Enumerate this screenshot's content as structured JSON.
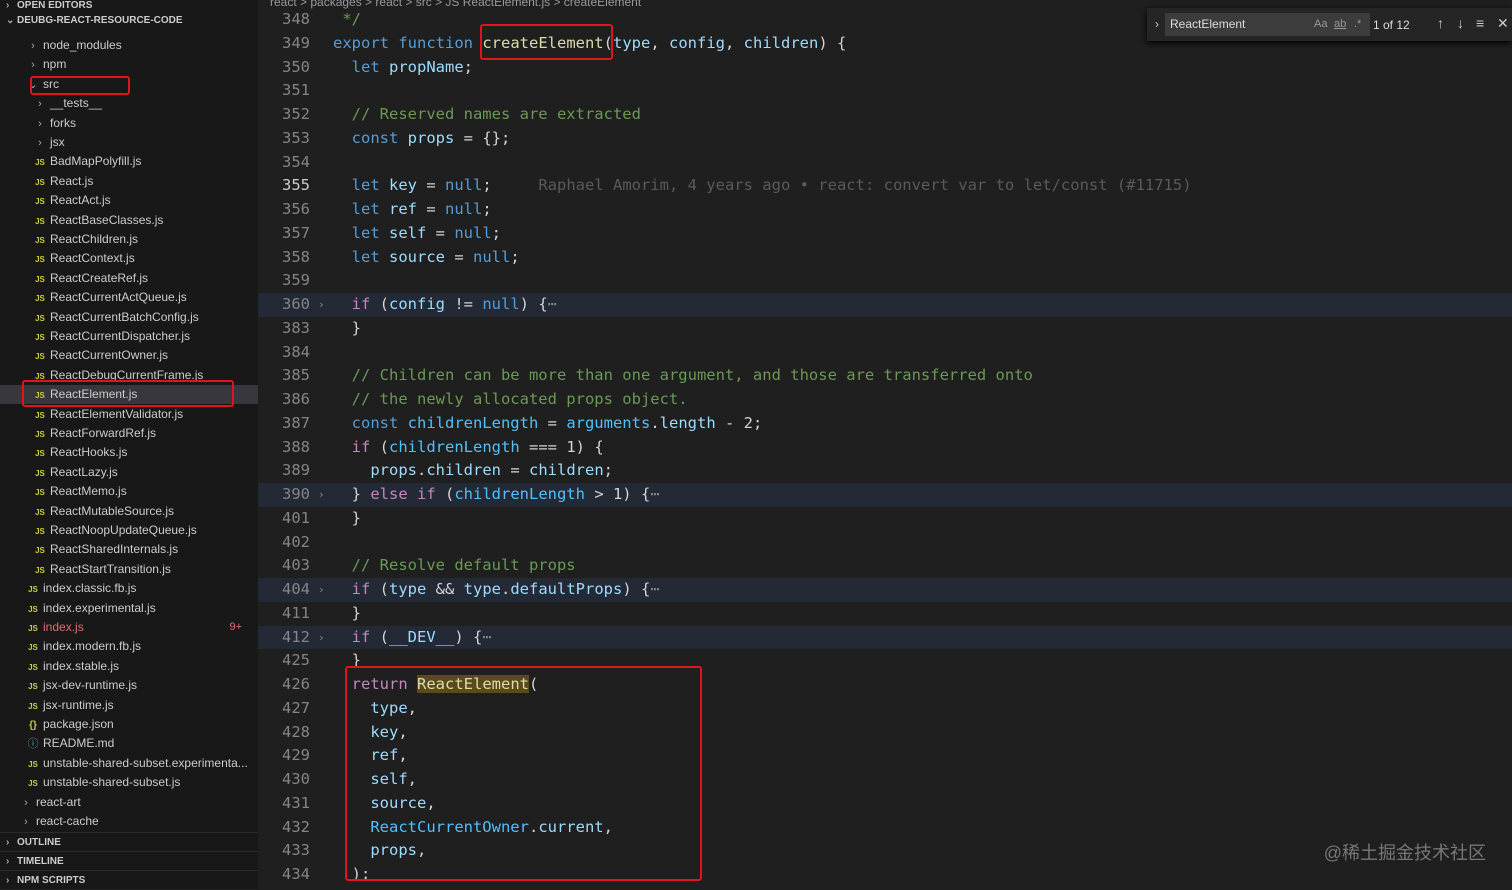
{
  "sidebar": {
    "open_editors": "OPEN EDITORS",
    "project": "DEUBG-REACT-RESOURCE-CODE",
    "tree": [
      {
        "label": "node_modules",
        "icon": "chevron-right",
        "depth": 1
      },
      {
        "label": "npm",
        "icon": "chevron-right",
        "depth": 1
      },
      {
        "label": "src",
        "icon": "chevron-down",
        "depth": 1,
        "boxed": true
      },
      {
        "label": "__tests__",
        "icon": "chevron-right",
        "depth": 2
      },
      {
        "label": "forks",
        "icon": "chevron-right",
        "depth": 2
      },
      {
        "label": "jsx",
        "icon": "chevron-right",
        "depth": 2
      },
      {
        "label": "BadMapPolyfill.js",
        "icon": "js",
        "depth": 2
      },
      {
        "label": "React.js",
        "icon": "js",
        "depth": 2
      },
      {
        "label": "ReactAct.js",
        "icon": "js",
        "depth": 2
      },
      {
        "label": "ReactBaseClasses.js",
        "icon": "js",
        "depth": 2
      },
      {
        "label": "ReactChildren.js",
        "icon": "js",
        "depth": 2
      },
      {
        "label": "ReactContext.js",
        "icon": "js",
        "depth": 2
      },
      {
        "label": "ReactCreateRef.js",
        "icon": "js",
        "depth": 2
      },
      {
        "label": "ReactCurrentActQueue.js",
        "icon": "js",
        "depth": 2
      },
      {
        "label": "ReactCurrentBatchConfig.js",
        "icon": "js",
        "depth": 2
      },
      {
        "label": "ReactCurrentDispatcher.js",
        "icon": "js",
        "depth": 2
      },
      {
        "label": "ReactCurrentOwner.js",
        "icon": "js",
        "depth": 2
      },
      {
        "label": "ReactDebugCurrentFrame.js",
        "icon": "js",
        "depth": 2
      },
      {
        "label": "ReactElement.js",
        "icon": "js",
        "depth": 2,
        "selected": true,
        "boxed": true
      },
      {
        "label": "ReactElementValidator.js",
        "icon": "js",
        "depth": 2
      },
      {
        "label": "ReactForwardRef.js",
        "icon": "js",
        "depth": 2
      },
      {
        "label": "ReactHooks.js",
        "icon": "js",
        "depth": 2
      },
      {
        "label": "ReactLazy.js",
        "icon": "js",
        "depth": 2
      },
      {
        "label": "ReactMemo.js",
        "icon": "js",
        "depth": 2
      },
      {
        "label": "ReactMutableSource.js",
        "icon": "js",
        "depth": 2
      },
      {
        "label": "ReactNoopUpdateQueue.js",
        "icon": "js",
        "depth": 2
      },
      {
        "label": "ReactSharedInternals.js",
        "icon": "js",
        "depth": 2
      },
      {
        "label": "ReactStartTransition.js",
        "icon": "js",
        "depth": 2
      },
      {
        "label": "index.classic.fb.js",
        "icon": "js",
        "depth": 1
      },
      {
        "label": "index.experimental.js",
        "icon": "js",
        "depth": 1
      },
      {
        "label": "index.js",
        "icon": "js",
        "depth": 1,
        "error": true,
        "badge": "9+"
      },
      {
        "label": "index.modern.fb.js",
        "icon": "js",
        "depth": 1
      },
      {
        "label": "index.stable.js",
        "icon": "js",
        "depth": 1
      },
      {
        "label": "jsx-dev-runtime.js",
        "icon": "js",
        "depth": 1
      },
      {
        "label": "jsx-runtime.js",
        "icon": "js",
        "depth": 1
      },
      {
        "label": "package.json",
        "icon": "json",
        "depth": 1
      },
      {
        "label": "README.md",
        "icon": "info",
        "depth": 1
      },
      {
        "label": "unstable-shared-subset.experimenta...",
        "icon": "js",
        "depth": 1
      },
      {
        "label": "unstable-shared-subset.js",
        "icon": "js",
        "depth": 1
      },
      {
        "label": "react-art",
        "icon": "chevron-right",
        "depth": 0
      },
      {
        "label": "react-cache",
        "icon": "chevron-right",
        "depth": 0
      }
    ],
    "sections": [
      "OUTLINE",
      "TIMELINE",
      "NPM SCRIPTS"
    ]
  },
  "breadcrumbs": "react > packages > react > src > JS ReactElement.js > createElement",
  "find": {
    "query": "ReactElement",
    "match_case": "Aa",
    "whole_word": "ab",
    "regex": ".*",
    "count": "1 of 12"
  },
  "lines": [
    {
      "n": "348",
      "t": [
        [
          " */",
          "c"
        ]
      ]
    },
    {
      "n": "349",
      "t": [
        [
          "export ",
          "k"
        ],
        [
          "function ",
          "k"
        ],
        [
          "createElement",
          "f"
        ],
        [
          "(",
          "t"
        ],
        [
          "type",
          "v"
        ],
        [
          ", ",
          "t"
        ],
        [
          "config",
          "v"
        ],
        [
          ", ",
          "t"
        ],
        [
          "children",
          "v"
        ],
        [
          ") {",
          "t"
        ]
      ]
    },
    {
      "n": "350",
      "t": [
        [
          "  let ",
          "k"
        ],
        [
          "propName",
          "v"
        ],
        [
          ";",
          "t"
        ]
      ]
    },
    {
      "n": "351",
      "t": []
    },
    {
      "n": "352",
      "t": [
        [
          "  // Reserved names are extracted",
          "c"
        ]
      ]
    },
    {
      "n": "353",
      "t": [
        [
          "  const ",
          "k"
        ],
        [
          "props",
          "v"
        ],
        [
          " = {};",
          "t"
        ]
      ]
    },
    {
      "n": "354",
      "t": []
    },
    {
      "n": "355",
      "cur": true,
      "t": [
        [
          "  let ",
          "k"
        ],
        [
          "key",
          "v"
        ],
        [
          " = ",
          "t"
        ],
        [
          "null",
          "k"
        ],
        [
          ";",
          "t"
        ],
        [
          "     Raphael Amorim, 4 years ago • react: convert var to let/const (#11715)",
          "blame"
        ]
      ]
    },
    {
      "n": "356",
      "t": [
        [
          "  let ",
          "k"
        ],
        [
          "ref",
          "v"
        ],
        [
          " = ",
          "t"
        ],
        [
          "null",
          "k"
        ],
        [
          ";",
          "t"
        ]
      ]
    },
    {
      "n": "357",
      "t": [
        [
          "  let ",
          "k"
        ],
        [
          "self",
          "v"
        ],
        [
          " = ",
          "t"
        ],
        [
          "null",
          "k"
        ],
        [
          ";",
          "t"
        ]
      ]
    },
    {
      "n": "358",
      "t": [
        [
          "  let ",
          "k"
        ],
        [
          "source",
          "v"
        ],
        [
          " = ",
          "t"
        ],
        [
          "null",
          "k"
        ],
        [
          ";",
          "t"
        ]
      ]
    },
    {
      "n": "359",
      "t": []
    },
    {
      "n": "360",
      "fold": true,
      "t": [
        [
          "  if ",
          "p"
        ],
        [
          "(",
          "t"
        ],
        [
          "config",
          "v"
        ],
        [
          " != ",
          "t"
        ],
        [
          "null",
          "k"
        ],
        [
          ") {",
          "t"
        ],
        [
          "⋯",
          "dots"
        ]
      ]
    },
    {
      "n": "383",
      "t": [
        [
          "  }",
          "t"
        ]
      ]
    },
    {
      "n": "384",
      "t": []
    },
    {
      "n": "385",
      "t": [
        [
          "  // Children can be more than one argument, and those are transferred onto",
          "c"
        ]
      ]
    },
    {
      "n": "386",
      "t": [
        [
          "  // the newly allocated props object.",
          "c"
        ]
      ]
    },
    {
      "n": "387",
      "t": [
        [
          "  const ",
          "k"
        ],
        [
          "childrenLength",
          "g"
        ],
        [
          " = ",
          "t"
        ],
        [
          "arguments",
          "g"
        ],
        [
          ".",
          "t"
        ],
        [
          "length",
          "v"
        ],
        [
          " - 2;",
          "t"
        ]
      ]
    },
    {
      "n": "388",
      "t": [
        [
          "  if ",
          "p"
        ],
        [
          "(",
          "t"
        ],
        [
          "childrenLength",
          "g"
        ],
        [
          " === 1) {",
          "t"
        ]
      ]
    },
    {
      "n": "389",
      "t": [
        [
          "    props",
          "v"
        ],
        [
          ".",
          "t"
        ],
        [
          "children",
          "v"
        ],
        [
          " = ",
          "t"
        ],
        [
          "children",
          "v"
        ],
        [
          ";",
          "t"
        ]
      ]
    },
    {
      "n": "390",
      "fold": true,
      "t": [
        [
          "  } ",
          "t"
        ],
        [
          "else if ",
          "p"
        ],
        [
          "(",
          "t"
        ],
        [
          "childrenLength",
          "g"
        ],
        [
          " > 1) {",
          "t"
        ],
        [
          "⋯",
          "dots"
        ]
      ]
    },
    {
      "n": "401",
      "t": [
        [
          "  }",
          "t"
        ]
      ]
    },
    {
      "n": "402",
      "t": []
    },
    {
      "n": "403",
      "t": [
        [
          "  // Resolve default props",
          "c"
        ]
      ]
    },
    {
      "n": "404",
      "fold": true,
      "t": [
        [
          "  if ",
          "p"
        ],
        [
          "(",
          "t"
        ],
        [
          "type",
          "v"
        ],
        [
          " && ",
          "t"
        ],
        [
          "type",
          "v"
        ],
        [
          ".",
          "t"
        ],
        [
          "defaultProps",
          "v"
        ],
        [
          ") {",
          "t"
        ],
        [
          "⋯",
          "dots"
        ]
      ]
    },
    {
      "n": "411",
      "t": [
        [
          "  }",
          "t"
        ]
      ]
    },
    {
      "n": "412",
      "fold": true,
      "t": [
        [
          "  if ",
          "p"
        ],
        [
          "(",
          "t"
        ],
        [
          "__DEV__",
          "v"
        ],
        [
          ") {",
          "t"
        ],
        [
          "⋯",
          "dots"
        ]
      ]
    },
    {
      "n": "425",
      "t": [
        [
          "  }",
          "t"
        ]
      ]
    },
    {
      "n": "426",
      "t": [
        [
          "  return ",
          "p"
        ],
        [
          "ReactElement",
          "hl"
        ],
        [
          "(",
          "t"
        ]
      ]
    },
    {
      "n": "427",
      "t": [
        [
          "    type",
          "v"
        ],
        [
          ",",
          "t"
        ]
      ]
    },
    {
      "n": "428",
      "t": [
        [
          "    key",
          "v"
        ],
        [
          ",",
          "t"
        ]
      ]
    },
    {
      "n": "429",
      "t": [
        [
          "    ref",
          "v"
        ],
        [
          ",",
          "t"
        ]
      ]
    },
    {
      "n": "430",
      "t": [
        [
          "    self",
          "v"
        ],
        [
          ",",
          "t"
        ]
      ]
    },
    {
      "n": "431",
      "t": [
        [
          "    source",
          "v"
        ],
        [
          ",",
          "t"
        ]
      ]
    },
    {
      "n": "432",
      "t": [
        [
          "    ReactCurrentOwner",
          "g"
        ],
        [
          ".",
          "t"
        ],
        [
          "current",
          "v"
        ],
        [
          ",",
          "t"
        ]
      ]
    },
    {
      "n": "433",
      "t": [
        [
          "    props",
          "v"
        ],
        [
          ",",
          "t"
        ]
      ]
    },
    {
      "n": "434",
      "t": [
        [
          "  );",
          "t"
        ]
      ]
    }
  ],
  "watermark": "@稀土掘金技术社区"
}
